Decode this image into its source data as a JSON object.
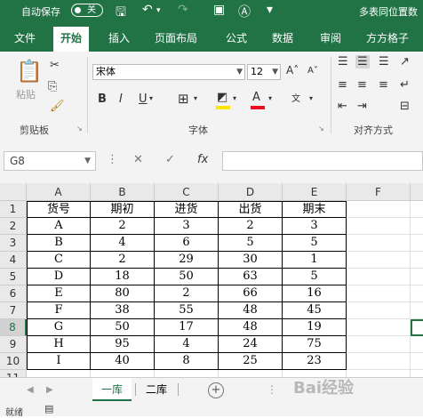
{
  "titlebar": {
    "autosave_label": "自动保存",
    "toggle_state": "关",
    "title": "多表同位置数"
  },
  "tabs": [
    "文件",
    "开始",
    "插入",
    "页面布局",
    "公式",
    "数据",
    "审阅",
    "方方格子"
  ],
  "ribbon": {
    "clipboard": {
      "paste_label": "粘贴",
      "group_label": "剪贴板"
    },
    "font": {
      "family": "宋体",
      "size": "12",
      "group_label": "字体",
      "bold": "B",
      "italic": "I",
      "underline": "U",
      "font_color": "#e81123",
      "fill_color": "#ffe600"
    },
    "alignment": {
      "group_label": "对齐方式"
    }
  },
  "namebox": {
    "value": "G8"
  },
  "formula": {
    "value": ""
  },
  "sheet": {
    "columns": [
      "A",
      "B",
      "C",
      "D",
      "E",
      "F"
    ],
    "rows": [
      "1",
      "2",
      "3",
      "4",
      "5",
      "6",
      "7",
      "8",
      "9",
      "10",
      "11"
    ],
    "selected_row": "8",
    "header_row": [
      "货号",
      "期初",
      "进货",
      "出货",
      "期末"
    ],
    "data_rows": [
      [
        "A",
        "2",
        "3",
        "2",
        "3"
      ],
      [
        "B",
        "4",
        "6",
        "5",
        "5"
      ],
      [
        "C",
        "2",
        "29",
        "30",
        "1"
      ],
      [
        "D",
        "18",
        "50",
        "63",
        "5"
      ],
      [
        "E",
        "80",
        "2",
        "66",
        "16"
      ],
      [
        "F",
        "38",
        "55",
        "48",
        "45"
      ],
      [
        "G",
        "50",
        "17",
        "48",
        "19"
      ],
      [
        "H",
        "95",
        "4",
        "24",
        "75"
      ],
      [
        "I",
        "40",
        "8",
        "25",
        "23"
      ]
    ]
  },
  "sheet_tabs": [
    "一库",
    "二库"
  ],
  "status": {
    "ready": "就绪"
  },
  "watermark": "Bai经验"
}
